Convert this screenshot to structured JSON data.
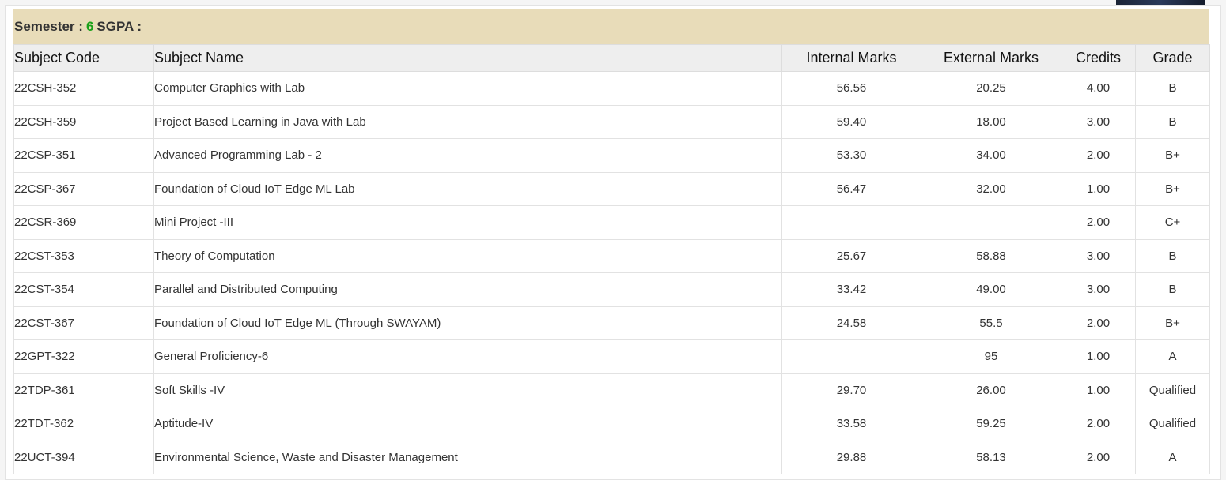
{
  "semester": {
    "label": "Semester :",
    "number": "6",
    "sgpa_label": "SGPA :"
  },
  "table": {
    "headers": {
      "code": "Subject Code",
      "name": "Subject Name",
      "internal": "Internal Marks",
      "external": "External Marks",
      "credits": "Credits",
      "grade": "Grade"
    },
    "rows": [
      {
        "code": "22CSH-352",
        "name": "Computer Graphics with Lab",
        "internal": "56.56",
        "external": "20.25",
        "credits": "4.00",
        "grade": "B"
      },
      {
        "code": "22CSH-359",
        "name": "Project Based Learning in Java with Lab",
        "internal": "59.40",
        "external": "18.00",
        "credits": "3.00",
        "grade": "B"
      },
      {
        "code": "22CSP-351",
        "name": "Advanced Programming Lab - 2",
        "internal": "53.30",
        "external": "34.00",
        "credits": "2.00",
        "grade": "B+"
      },
      {
        "code": "22CSP-367",
        "name": "Foundation of Cloud IoT Edge ML Lab",
        "internal": "56.47",
        "external": "32.00",
        "credits": "1.00",
        "grade": "B+"
      },
      {
        "code": "22CSR-369",
        "name": "Mini Project -III",
        "internal": "",
        "external": "",
        "credits": "2.00",
        "grade": "C+"
      },
      {
        "code": "22CST-353",
        "name": "Theory of Computation",
        "internal": "25.67",
        "external": "58.88",
        "credits": "3.00",
        "grade": "B"
      },
      {
        "code": "22CST-354",
        "name": "Parallel and Distributed Computing",
        "internal": "33.42",
        "external": "49.00",
        "credits": "3.00",
        "grade": "B"
      },
      {
        "code": "22CST-367",
        "name": "Foundation of Cloud IoT Edge ML (Through SWAYAM)",
        "internal": "24.58",
        "external": "55.5",
        "credits": "2.00",
        "grade": "B+"
      },
      {
        "code": "22GPT-322",
        "name": "General Proficiency-6",
        "internal": "",
        "external": "95",
        "credits": "1.00",
        "grade": "A"
      },
      {
        "code": "22TDP-361",
        "name": "Soft Skills -IV",
        "internal": "29.70",
        "external": "26.00",
        "credits": "1.00",
        "grade": "Qualified"
      },
      {
        "code": "22TDT-362",
        "name": "Aptitude-IV",
        "internal": "33.58",
        "external": "59.25",
        "credits": "2.00",
        "grade": "Qualified"
      },
      {
        "code": "22UCT-394",
        "name": "Environmental Science, Waste and Disaster Management",
        "internal": "29.88",
        "external": "58.13",
        "credits": "2.00",
        "grade": "A"
      }
    ]
  }
}
